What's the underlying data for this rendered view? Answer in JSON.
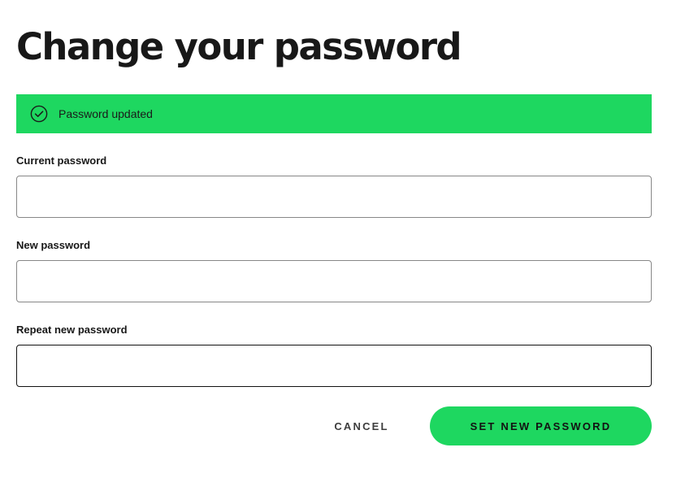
{
  "page": {
    "title": "Change your password"
  },
  "banner": {
    "icon": "check-circle-icon",
    "message": "Password updated",
    "color": "#1ed760"
  },
  "form": {
    "current_password": {
      "label": "Current password",
      "value": ""
    },
    "new_password": {
      "label": "New password",
      "value": ""
    },
    "repeat_password": {
      "label": "Repeat new password",
      "value": ""
    }
  },
  "actions": {
    "cancel_label": "CANCEL",
    "submit_label": "SET NEW PASSWORD"
  },
  "colors": {
    "accent": "#1ed760",
    "text": "#181818"
  }
}
